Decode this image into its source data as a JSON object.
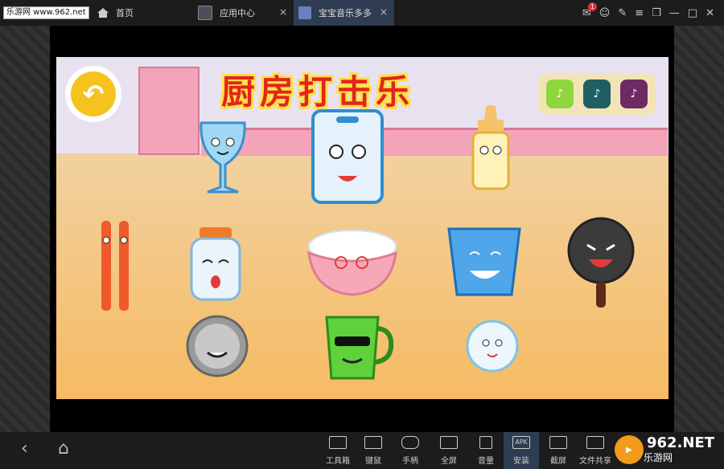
{
  "titlebar": {
    "brand_badge": "乐游网 www.962.net",
    "home_label": "首页",
    "tabs": [
      {
        "label": "应用中心",
        "close": "×"
      },
      {
        "label": "宝宝音乐多多",
        "close": "×"
      }
    ],
    "notification_count": "1"
  },
  "game": {
    "title": "厨房打击乐",
    "back_arrow": "↶",
    "palette_buttons": [
      {
        "label": "♪",
        "color": "#8fd63e"
      },
      {
        "label": "♪",
        "color": "#1f5f63"
      },
      {
        "label": "♪",
        "color": "#6d2a63"
      }
    ]
  },
  "bottombar": {
    "tools": [
      {
        "label": "工具箱"
      },
      {
        "label": "键鼠"
      },
      {
        "label": "手柄"
      },
      {
        "label": "全屏"
      },
      {
        "label": "音量"
      },
      {
        "label": "安装"
      },
      {
        "label": "截屏"
      },
      {
        "label": "文件共享"
      }
    ],
    "apk_text": "APK",
    "logo_text": "962.NET",
    "logo_sub": "乐游网"
  }
}
